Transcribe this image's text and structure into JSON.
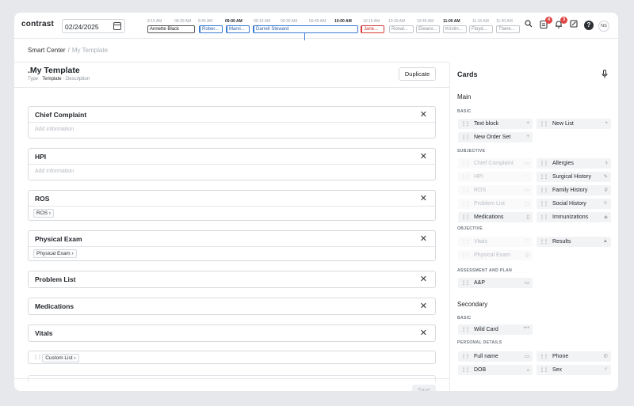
{
  "app": {
    "logo": "contrast",
    "date": "02/24/2025",
    "avatar": "NS",
    "badges": {
      "tasks": "4",
      "notifications": "3"
    }
  },
  "timeline": {
    "ticks": [
      {
        "label": "8:15 AM",
        "hour": false
      },
      {
        "label": "08:30 AM",
        "hour": false
      },
      {
        "label": "8:45 AM",
        "hour": false
      },
      {
        "label": "09:00 AM",
        "hour": true
      },
      {
        "label": "09:15 AM",
        "hour": false
      },
      {
        "label": "09:30 AM",
        "hour": false
      },
      {
        "label": "09:45 AM",
        "hour": false
      },
      {
        "label": "10:00 AM",
        "hour": true
      },
      {
        "label": "10:15 AM",
        "hour": false
      },
      {
        "label": "10:30 AM",
        "hour": false
      },
      {
        "label": "10:45 AM",
        "hour": false
      },
      {
        "label": "11:00 AM",
        "hour": true
      },
      {
        "label": "11:15 AM",
        "hour": false
      },
      {
        "label": "11:30 AM",
        "hour": false
      }
    ],
    "appointments": [
      {
        "name": "Annette Black",
        "style": "dark"
      },
      {
        "name": "Rober...",
        "style": "blue"
      },
      {
        "name": "Marvi...",
        "style": "blue"
      },
      {
        "name": "Darrell Steward",
        "style": "blue"
      },
      {
        "name": "Jane...",
        "style": "red"
      },
      {
        "name": "Ronal...",
        "style": "grey"
      },
      {
        "name": "Eleano...",
        "style": "grey"
      },
      {
        "name": "Kristin...",
        "style": "grey"
      },
      {
        "name": "Floyd...",
        "style": "grey"
      },
      {
        "name": "There...",
        "style": "grey"
      }
    ]
  },
  "breadcrumb": {
    "root": "Smart Center",
    "separator": "/",
    "current": "My Template"
  },
  "template": {
    "title": ".My Template",
    "type_label": "Type ·",
    "type_value": "Template",
    "description": "· Description",
    "duplicate_label": "Duplicate",
    "save_label": "Save",
    "sections": [
      {
        "title": "Chief Complaint",
        "placeholder": "Add information",
        "chip": ""
      },
      {
        "title": "HPI",
        "placeholder": "Add information",
        "chip": ""
      },
      {
        "title": "ROS",
        "placeholder": "",
        "chip": "ROS"
      },
      {
        "title": "Physical Exam",
        "placeholder": "",
        "chip": "Physical Exam"
      },
      {
        "title": "Problem List",
        "placeholder": "",
        "chip": ""
      },
      {
        "title": "Medications",
        "placeholder": "",
        "chip": ""
      },
      {
        "title": "Vitals",
        "placeholder": "",
        "chip": ""
      }
    ],
    "custom_list": "Custom List"
  },
  "cards_panel": {
    "title": "Cards",
    "main": {
      "label": "Main",
      "basic_label": "BASIC",
      "basic": [
        {
          "label": "Text block",
          "icon": "+",
          "disabled": false
        },
        {
          "label": "New List",
          "icon": "+",
          "disabled": false
        },
        {
          "label": "New Order Set",
          "icon": "+",
          "disabled": false
        }
      ],
      "subjective_label": "SUBJECTIVE",
      "subjective": [
        {
          "label": "Chief Complaint",
          "icon": "▭",
          "disabled": true
        },
        {
          "label": "Allergies",
          "icon": "⚕",
          "disabled": false
        },
        {
          "label": "HPI",
          "icon": "◌",
          "disabled": true
        },
        {
          "label": "Surgical History",
          "icon": "✎",
          "disabled": false
        },
        {
          "label": "ROS",
          "icon": "▭",
          "disabled": true
        },
        {
          "label": "Family History",
          "icon": "⚲",
          "disabled": false
        },
        {
          "label": "Problem List",
          "icon": "▢",
          "disabled": true
        },
        {
          "label": "Social History",
          "icon": "☺",
          "disabled": false
        },
        {
          "label": "Medications",
          "icon": "▯",
          "disabled": false
        },
        {
          "label": "Immunizations",
          "icon": "◈",
          "disabled": false
        }
      ],
      "objective_label": "OBJECTIVE",
      "objective": [
        {
          "label": "Vitals",
          "icon": "♡",
          "disabled": true
        },
        {
          "label": "Results",
          "icon": "▲",
          "disabled": false
        },
        {
          "label": "Physical Exam",
          "icon": "◎",
          "disabled": true
        }
      ],
      "assessment_label": "ASSESSMENT AND PLAN",
      "assessment": [
        {
          "label": "A&P",
          "icon": "▭",
          "disabled": false
        }
      ]
    },
    "secondary": {
      "label": "Secondary",
      "basic_label": "BASIC",
      "basic": [
        {
          "label": "Wild Card",
          "icon": "***",
          "disabled": false
        }
      ],
      "personal_label": "PERSONAL DETAILS",
      "personal": [
        {
          "label": "Full name",
          "icon": "▭",
          "disabled": false
        },
        {
          "label": "Phone",
          "icon": "✆",
          "disabled": false
        },
        {
          "label": "DOB",
          "icon": "▵",
          "disabled": false
        },
        {
          "label": "Sex",
          "icon": "♂",
          "disabled": false
        }
      ]
    }
  }
}
